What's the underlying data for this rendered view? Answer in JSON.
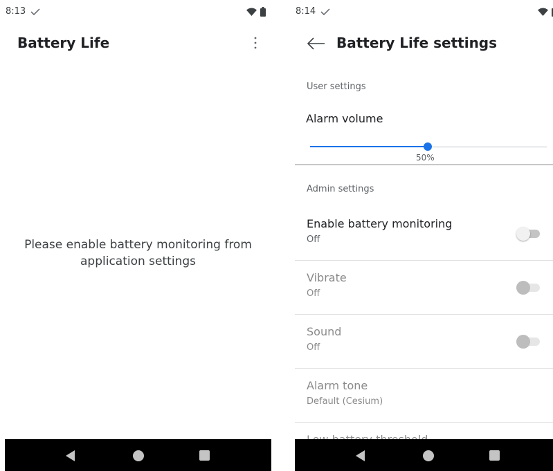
{
  "left_screen": {
    "status": {
      "time": "8:13"
    },
    "appbar": {
      "title": "Battery Life"
    },
    "message": "Please enable battery monitoring from application settings"
  },
  "right_screen": {
    "status": {
      "time": "8:14"
    },
    "appbar": {
      "title": "Battery Life settings"
    },
    "user_settings": {
      "header": "User settings",
      "alarm_volume": {
        "title": "Alarm volume",
        "value_label": "50%",
        "value": 0.5
      }
    },
    "admin_settings": {
      "header": "Admin settings",
      "items": [
        {
          "title": "Enable battery monitoring",
          "summary": "Off",
          "enabled": true,
          "checked": false
        },
        {
          "title": "Vibrate",
          "summary": "Off",
          "enabled": false,
          "checked": false
        },
        {
          "title": "Sound",
          "summary": "Off",
          "enabled": false,
          "checked": false
        },
        {
          "title": "Alarm tone",
          "summary": "Default (Cesium)",
          "enabled": false
        },
        {
          "title": "Low battery threshold",
          "summary": "",
          "enabled": false
        }
      ]
    }
  },
  "colors": {
    "accent": "#1a73e8",
    "navbar": "#000000"
  }
}
